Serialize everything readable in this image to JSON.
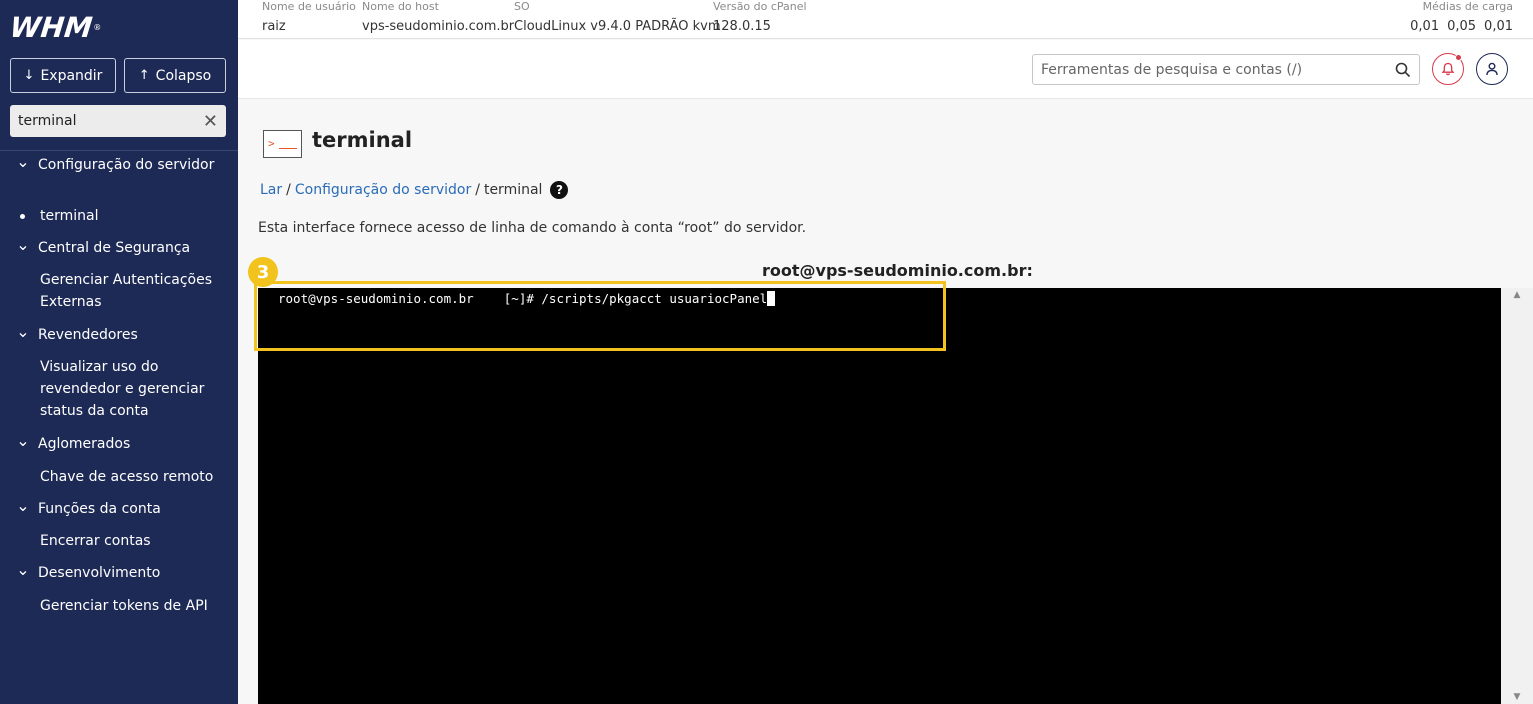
{
  "logo": {
    "text": "WHM",
    "reg": "®"
  },
  "sidebar": {
    "expand_label": "Expandir",
    "collapse_label": "Colapso",
    "search_value": "terminal",
    "items": [
      {
        "type": "category",
        "label": "Configuração do servidor",
        "top": 0,
        "h": 44
      },
      {
        "type": "sub",
        "label": "terminal",
        "active": true
      },
      {
        "type": "category",
        "label": "Central de Segurança"
      },
      {
        "type": "sub",
        "label": "Gerenciar Autenticações Externas"
      },
      {
        "type": "category",
        "label": "Revendedores"
      },
      {
        "type": "sub",
        "label": "Visualizar uso do revendedor e gerenciar status da conta"
      },
      {
        "type": "category",
        "label": "Aglomerados"
      },
      {
        "type": "sub",
        "label": "Chave de acesso remoto"
      },
      {
        "type": "category",
        "label": "Funções da conta"
      },
      {
        "type": "sub",
        "label": "Encerrar contas"
      },
      {
        "type": "category",
        "label": "Desenvolvimento"
      },
      {
        "type": "sub",
        "label": "Gerenciar tokens de API"
      }
    ]
  },
  "server_info": {
    "user_label": "Nome de usuário",
    "user": "raiz",
    "host_label": "Nome do host",
    "host": "vps-seudominio.com.br",
    "os_label": "SO",
    "os": "CloudLinux v9.4.0 PADRÃO kvm",
    "cpanel_label": "Versão do cPanel",
    "cpanel": "128.0.15",
    "load_label": "Médias de carga",
    "loads": [
      "0,01",
      "0,05",
      "0,01"
    ]
  },
  "header": {
    "search_placeholder": "Ferramentas de pesquisa e contas (/)"
  },
  "content": {
    "title": "terminal",
    "breadcrumb": {
      "home": "Lar",
      "section": "Configuração do servidor",
      "current": "terminal",
      "sep": "/"
    },
    "description": "Esta interface fornece acesso de linha de comando à conta “root” do servidor.",
    "terminal_host": "root@vps-seudominio.com.br:",
    "terminal_line": "root@vps-seudominio.com.br    [~]# /scripts/pkgacct usuariocPanel"
  },
  "annotation": {
    "step": "3",
    "color": "#f2c31d"
  }
}
